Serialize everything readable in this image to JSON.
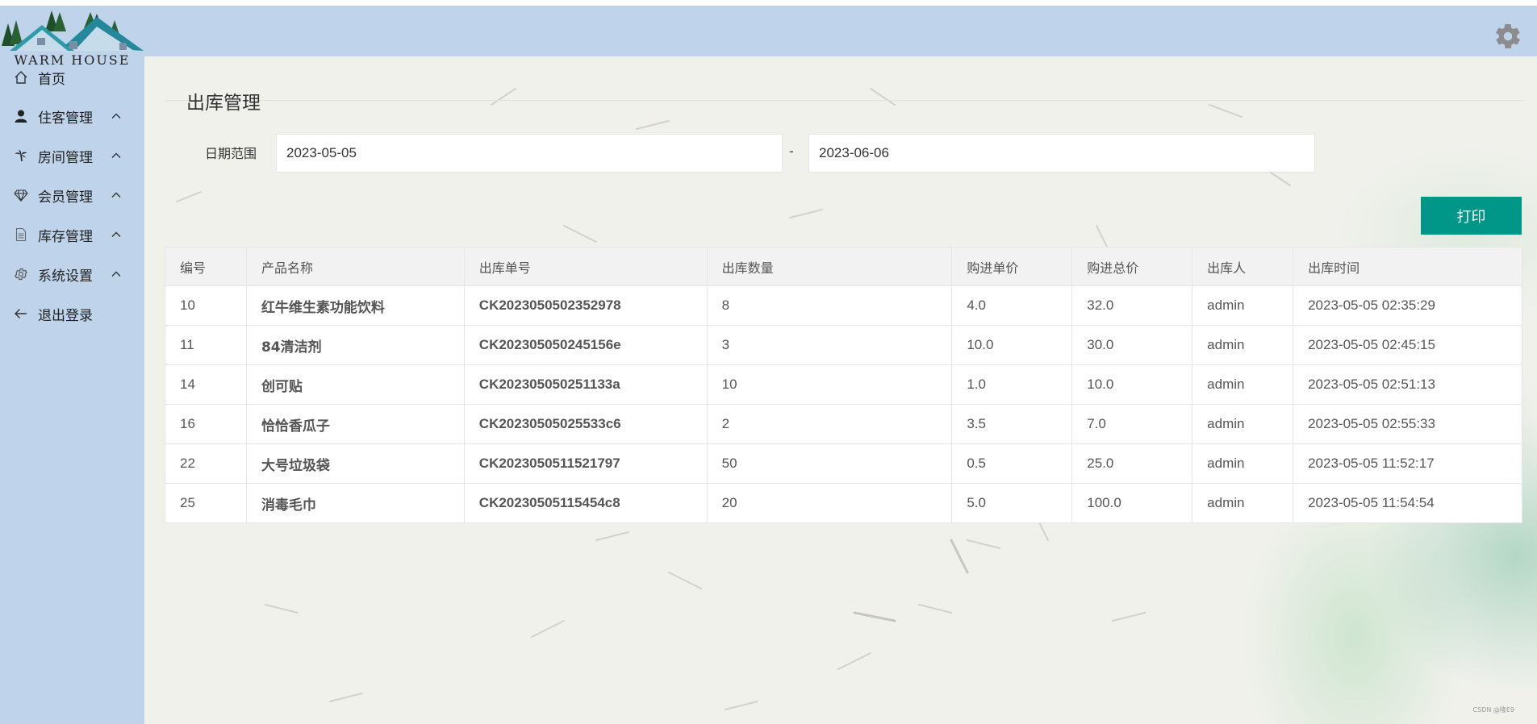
{
  "brand": {
    "logo_text": "WARM HOUSE"
  },
  "sidebar": {
    "items": [
      {
        "label": "首页",
        "icon": "home-icon",
        "has_caret": false
      },
      {
        "label": "住客管理",
        "icon": "user-icon",
        "has_caret": true
      },
      {
        "label": "房间管理",
        "icon": "palm-icon",
        "has_caret": true
      },
      {
        "label": "会员管理",
        "icon": "diamond-icon",
        "has_caret": true
      },
      {
        "label": "库存管理",
        "icon": "file-icon",
        "has_caret": true
      },
      {
        "label": "系统设置",
        "icon": "gear-icon",
        "has_caret": true
      },
      {
        "label": "退出登录",
        "icon": "arrow-left-icon",
        "has_caret": false
      }
    ]
  },
  "header": {
    "settings_icon": "gear-icon"
  },
  "page": {
    "title": "出库管理",
    "date_label": "日期范围",
    "date_start": "2023-05-05",
    "date_separator": "-",
    "date_end": "2023-06-06",
    "print_label": "打印"
  },
  "table": {
    "columns": [
      "编号",
      "产品名称",
      "出库单号",
      "出库数量",
      "购进单价",
      "购进总价",
      "出库人",
      "出库时间"
    ],
    "rows": [
      [
        "10",
        "红牛维生素功能饮料",
        "CK2023050502352978",
        "8",
        "4.0",
        "32.0",
        "admin",
        "2023-05-05 02:35:29"
      ],
      [
        "11",
        "84清洁剂",
        "CK202305050245156e",
        "3",
        "10.0",
        "30.0",
        "admin",
        "2023-05-05 02:45:15"
      ],
      [
        "14",
        "创可贴",
        "CK202305050251133a",
        "10",
        "1.0",
        "10.0",
        "admin",
        "2023-05-05 02:51:13"
      ],
      [
        "16",
        "恰恰香瓜子",
        "CK20230505025533c6",
        "2",
        "3.5",
        "7.0",
        "admin",
        "2023-05-05 02:55:33"
      ],
      [
        "22",
        "大号垃圾袋",
        "CK2023050511521797",
        "50",
        "0.5",
        "25.0",
        "admin",
        "2023-05-05 11:52:17"
      ],
      [
        "25",
        "消毒毛巾",
        "CK20230505115454c8",
        "20",
        "5.0",
        "100.0",
        "admin",
        "2023-05-05 11:54:54"
      ]
    ]
  },
  "watermark": "CSDN @隆E9",
  "colors": {
    "sidebar_bg": "#bfd3ea",
    "primary_button": "#009688"
  }
}
